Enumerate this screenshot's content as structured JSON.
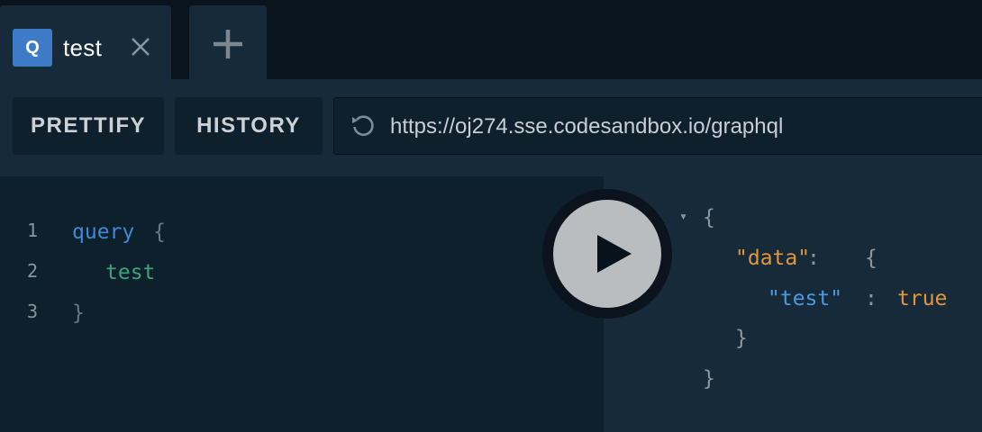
{
  "tabs": [
    {
      "badge": "Q",
      "title": "test"
    }
  ],
  "toolbar": {
    "prettify_label": "PRETTIFY",
    "history_label": "HISTORY",
    "endpoint_url": "https://oj274.sse.codesandbox.io/graphql"
  },
  "editor": {
    "line_numbers": [
      "1",
      "2",
      "3"
    ],
    "tokens": {
      "keyword": "query",
      "open_brace": "{",
      "field": "test",
      "close_brace": "}"
    }
  },
  "result": {
    "collapse_toggle": "▾",
    "open_brace": "{",
    "data_key": "\"data\"",
    "colon": ":",
    "inner_open": "{",
    "test_key": "\"test\"",
    "test_value": "true",
    "inner_close": "}",
    "outer_close": "}"
  },
  "icons": {
    "tab_close": "close-icon",
    "add_tab": "plus-icon",
    "reload": "reload-icon",
    "run": "play-icon"
  },
  "colors": {
    "accent": "#3d7bc7",
    "keyword": "#3c8ad9",
    "field": "#3ea47a",
    "json_key": "#e2963a",
    "json_subkey": "#4a9ae0"
  }
}
